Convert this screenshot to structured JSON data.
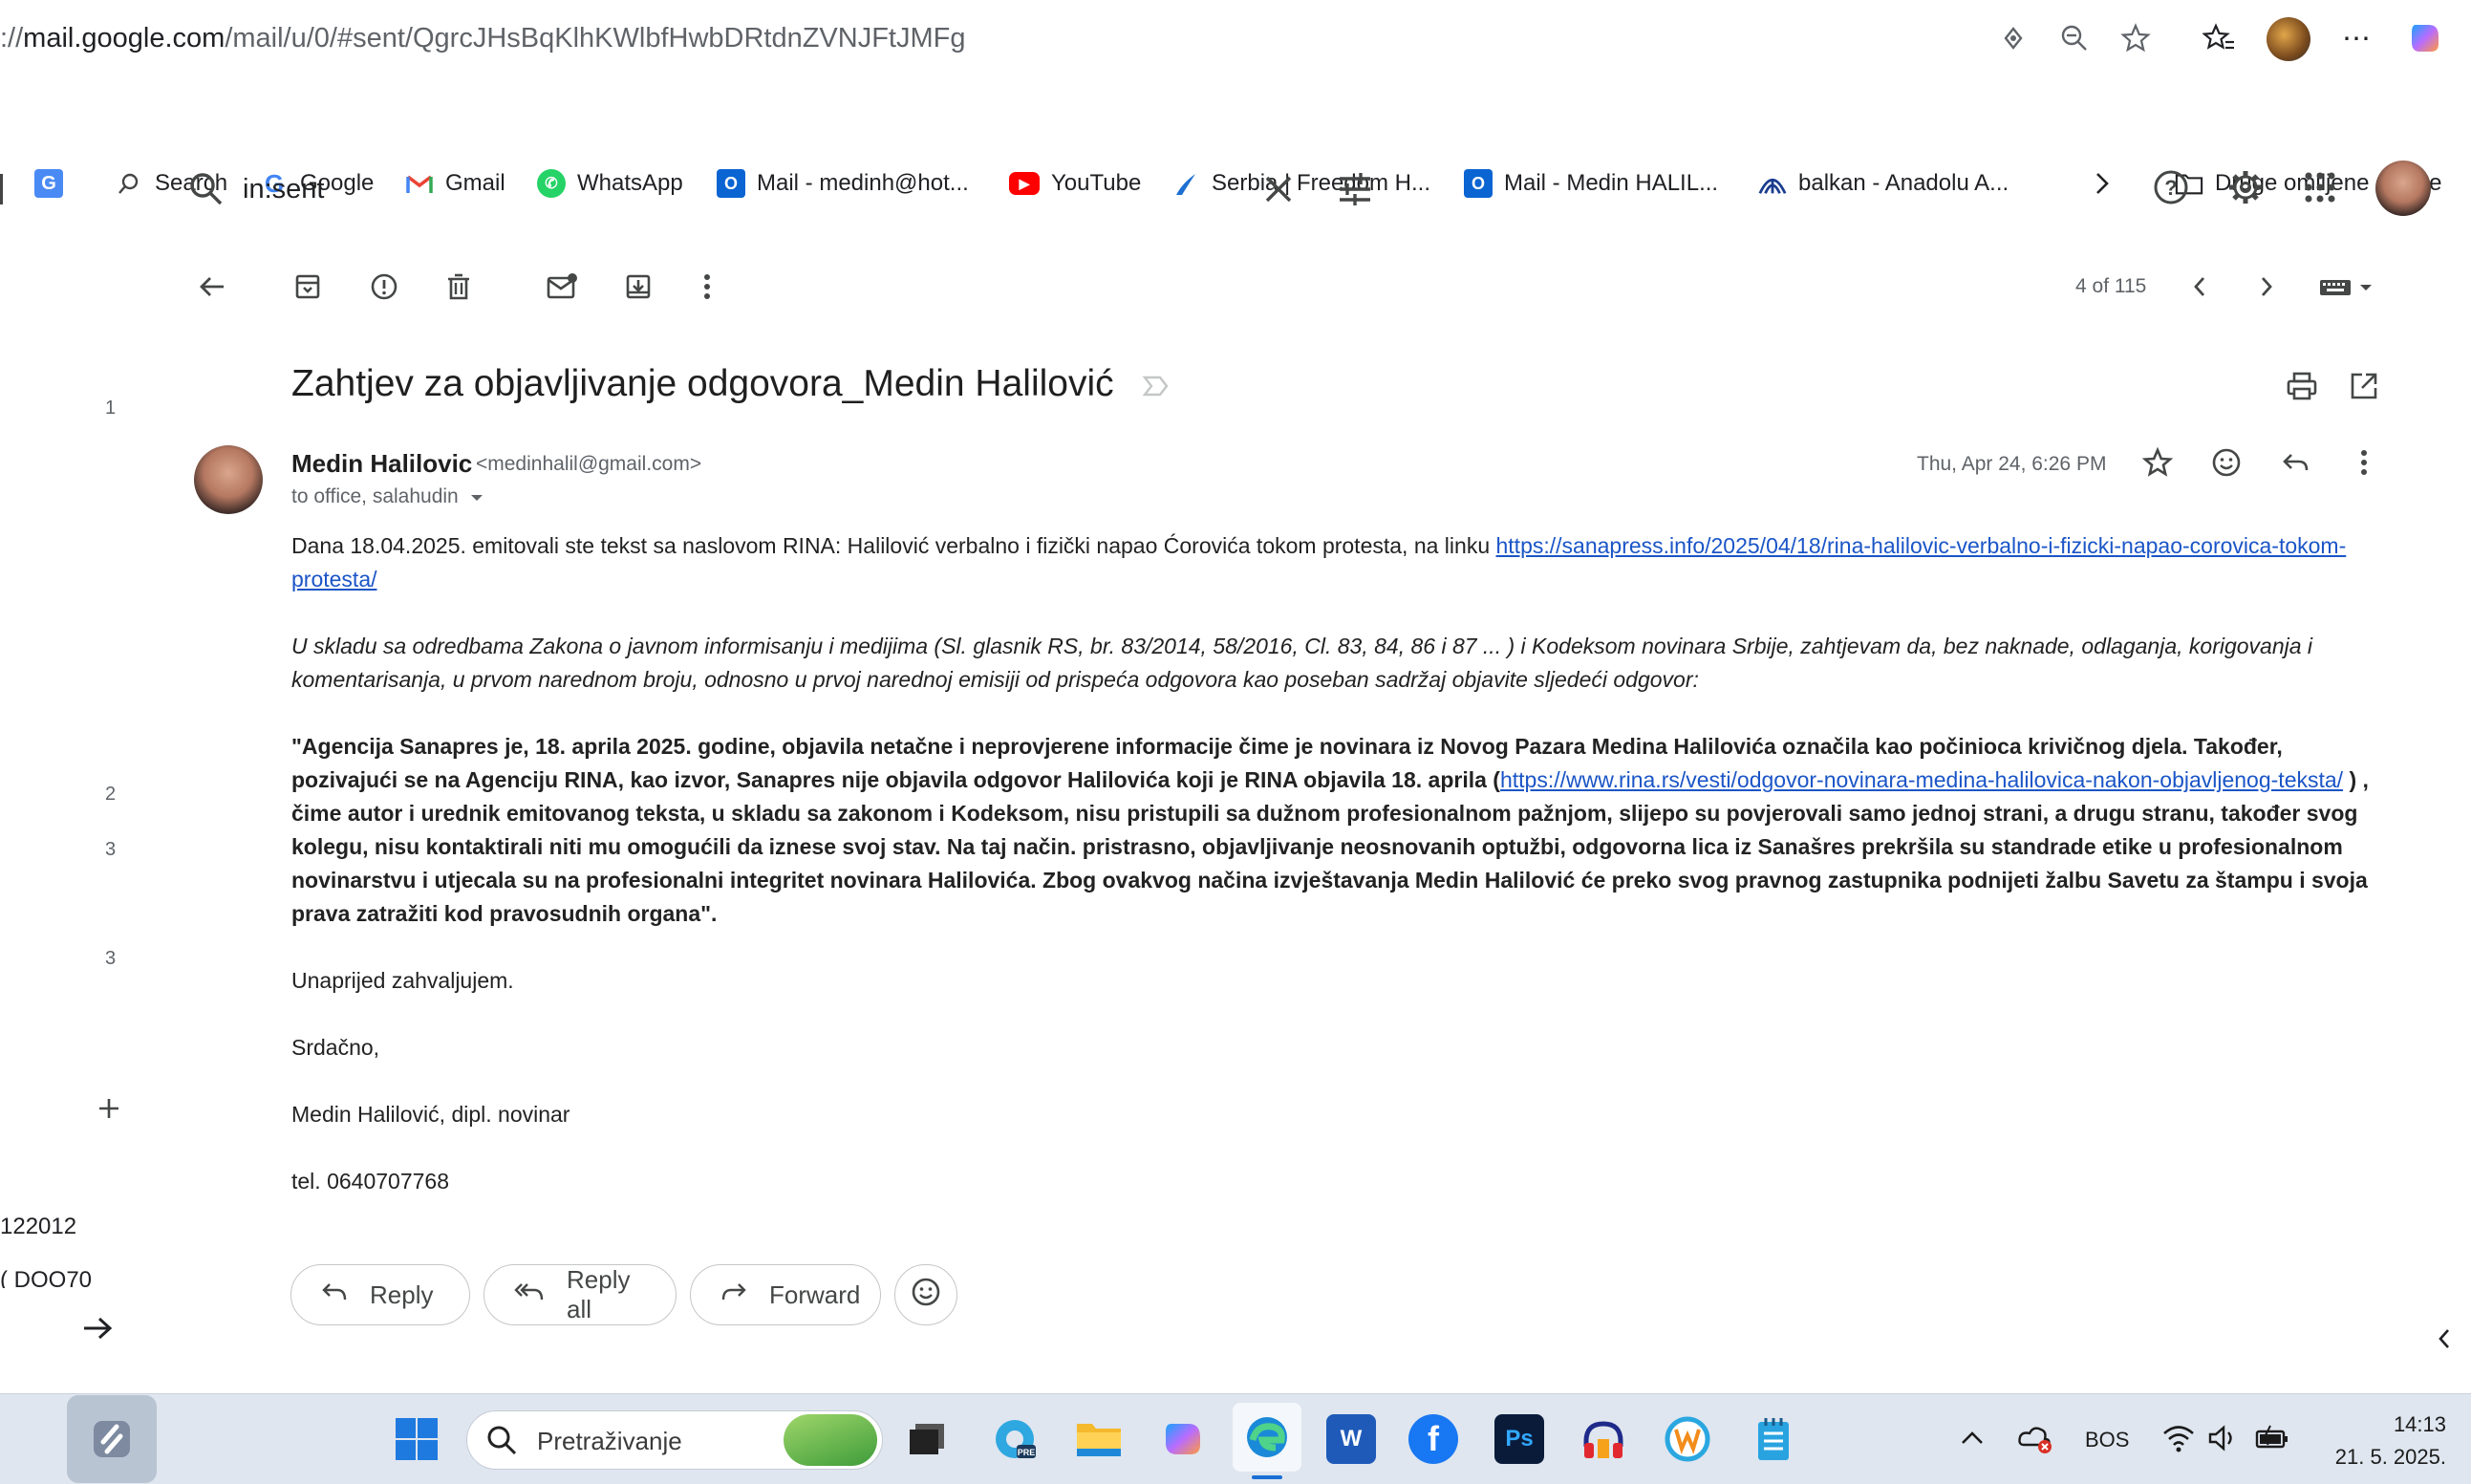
{
  "browser": {
    "url_prefix": "://",
    "url_host": "mail.google.com",
    "url_path": "/mail/u/0/#sent/QgrcJHsBqKlhKWlbfHwbDRtdnZVNJFtJMFg"
  },
  "bookmarks": [
    {
      "label": "Search",
      "icon": "search-icon"
    },
    {
      "label": "Google",
      "icon": "google-icon"
    },
    {
      "label": "Gmail",
      "icon": "gmail-icon"
    },
    {
      "label": "WhatsApp",
      "icon": "whatsapp-icon"
    },
    {
      "label": "Mail - medinh@hot...",
      "icon": "outlook-icon"
    },
    {
      "label": "YouTube",
      "icon": "youtube-icon"
    },
    {
      "label": "Serbia | Freedom H...",
      "icon": "freedom-house-icon"
    },
    {
      "label": "Mail - Medin HALIL...",
      "icon": "outlook-icon"
    },
    {
      "label": "balkan - Anadolu A...",
      "icon": "anadolu-icon"
    },
    {
      "label": "Druge omiljene stavke",
      "icon": "folder-icon"
    }
  ],
  "search": {
    "query": "in:sent"
  },
  "toolbar": {
    "pager": "4 of 115"
  },
  "email": {
    "subject": "Zahtjev za objavljivanje odgovora_Medin Halilović",
    "sender_name": "Medin Halilovic",
    "sender_email": "<medinhalil@gmail.com>",
    "to_line": "to office, salahudin",
    "date": "Thu, Apr 24, 6:26 PM",
    "body": {
      "p1_text": "Dana 18.04.2025. emitovali ste tekst sa naslovom RINA: Halilović verbalno i fizički napao Ćorovića tokom protesta, na linku ",
      "p1_link": "https://sanapress.info/2025/04/18/rina-halilovic-verbalno-i-fizicki-napao-corovica-tokom-protesta/",
      "p2": " U skladu sa odredbama Zakona o javnom informisanju i medijima (Sl. glasnik RS, br. 83/2014, 58/2016, Cl. 83, 84, 86 i 87 ... ) i Kodeksom novinara Srbije, zahtjevam da, bez naknade, odlaganja, korigovanja i komentarisanja, u prvom narednom broju, odnosno u prvoj narednoj  emisiji od prispeća odgovora kao poseban sadržaj objavite sljedeći odgovor:",
      "p3_a": "\"Agencija Sanapres je, 18. aprila 2025. godine, objavila netačne i neprovjerene informacije čime je novinara iz Novog Pazara Medina Halilovića označila kao počinioca krivičnog djela.  Također, pozivajući se na Agenciju RINA, kao izvor, Sanapres nije objavila odgovor Halilovića koji je RINA objavila 18. aprila  (",
      "p3_link": "https://www.rina.rs/vesti/odgovor-novinara-medina-halilovica-nakon-objavljenog-teksta/",
      "p3_b": " ) ,  čime autor i urednik emitovanog teksta, u skladu sa zakonom i Kodeksom, nisu pristupili sa dužnom profesionalnom pažnjom, slijepo su povjerovali samo jednoj strani, a drugu stranu, također svog kolegu, nisu kontaktirali niti mu omogućili da iznese svoj stav. Na taj način. pristrasno, objavljivanje neosnovanih optužbi, odgovorna lica iz Sanašres prekršila su standrade etike u profesionalnom novinarstvu i utjecala su na profesionalni integritet novinara Halilovića. Zbog ovakvog načina izvještavanja Medin Halilović će preko svog pravnog zastupnika podnijeti žalbu Savetu za štampu i svoja prava zatražiti kod pravosudnih organa\".",
      "p4": "Unaprijed zahvaljujem.",
      "p5": "Srdačno,",
      "p6": "Medin Halilović, dipl. novinar",
      "p7": "tel. 0640707768"
    },
    "actions": {
      "reply": "Reply",
      "reply_all": "Reply all",
      "forward": "Forward"
    }
  },
  "left_nav": {
    "counts": [
      "1",
      "2",
      "3",
      "3"
    ],
    "labels": [
      "122012",
      "( DOO70"
    ]
  },
  "taskbar": {
    "search_placeholder": "Pretraživanje",
    "language": "BOS",
    "time": "14:13",
    "date": "21. 5. 2025."
  },
  "colors": {
    "link": "#1a55c7",
    "taskbar": "#dfe6ef"
  }
}
